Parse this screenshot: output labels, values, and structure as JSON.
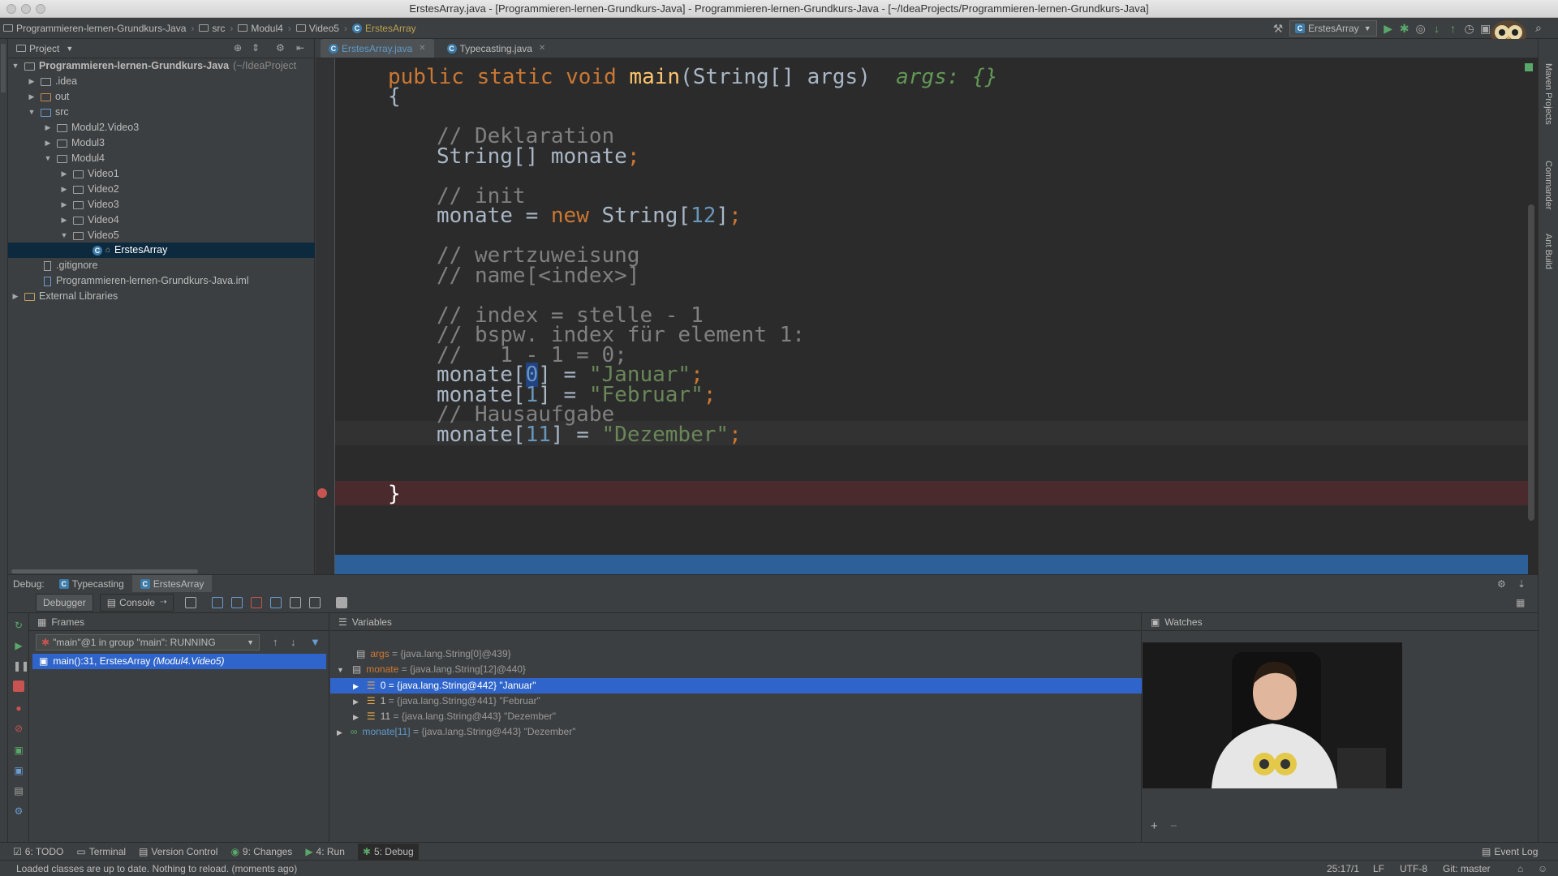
{
  "window": {
    "title": "ErstesArray.java - [Programmieren-lernen-Grundkurs-Java] - Programmieren-lernen-Grundkurs-Java - [~/IdeaProjects/Programmieren-lernen-Grundkurs-Java]"
  },
  "breadcrumbs": [
    "Programmieren-lernen-Grundkurs-Java",
    "src",
    "Modul4",
    "Video5",
    "ErstesArray"
  ],
  "run_config": "ErstesArray",
  "project": {
    "header": "Project",
    "root": "Programmieren-lernen-Grundkurs-Java",
    "root_path": "(~/IdeaProject",
    "items": [
      {
        "label": ".idea"
      },
      {
        "label": "out"
      },
      {
        "label": "src"
      },
      {
        "label": "Modul2.Video3"
      },
      {
        "label": "Modul3"
      },
      {
        "label": "Modul4"
      },
      {
        "label": "Video1"
      },
      {
        "label": "Video2"
      },
      {
        "label": "Video3"
      },
      {
        "label": "Video4"
      },
      {
        "label": "Video5"
      },
      {
        "label": "ErstesArray"
      },
      {
        "label": ".gitignore"
      },
      {
        "label": "Programmieren-lernen-Grundkurs-Java.iml"
      },
      {
        "label": "External Libraries"
      }
    ]
  },
  "editor": {
    "tabs": [
      {
        "label": "ErstesArray.java"
      },
      {
        "label": "Typecasting.java"
      }
    ]
  },
  "debug": {
    "label": "Debug:",
    "tabs": [
      "Typecasting",
      "ErstesArray"
    ],
    "subtabs": [
      "Debugger",
      "Console"
    ],
    "frames_header": "Frames",
    "thread": "\"main\"@1 in group \"main\": RUNNING",
    "frame": "main():31, ErstesArray",
    "frame_pkg": "(Modul4.Video5)",
    "variables_header": "Variables",
    "watches_header": "Watches",
    "variables": [
      {
        "name": "args",
        "value": "= {java.lang.String[0]@439}"
      },
      {
        "name": "monate",
        "value": "= {java.lang.String[12]@440}"
      },
      {
        "name": "0",
        "value": "= {java.lang.String@442} \"Januar\""
      },
      {
        "name": "1",
        "value": "= {java.lang.String@441} \"Februar\""
      },
      {
        "name": "11",
        "value": "= {java.lang.String@443} \"Dezember\""
      },
      {
        "name": "monate[11]",
        "value": "= {java.lang.String@443} \"Dezember\""
      }
    ]
  },
  "bottom_tools": [
    "6: TODO",
    "Terminal",
    "Version Control",
    "9: Changes",
    "4: Run",
    "5: Debug"
  ],
  "event_log": "Event Log",
  "status": {
    "message": "Loaded classes are up to date. Nothing to reload. (moments ago)",
    "position": "25:17/1",
    "line_sep": "LF",
    "encoding": "UTF-8",
    "git": "Git: master"
  },
  "right_strip": [
    "Maven Projects",
    "Commander",
    "Ant Build"
  ],
  "colors": {
    "keyword": "#cc7832",
    "string": "#6a8759",
    "number": "#6897bb",
    "comment": "#808080",
    "selection": "#2f65ca",
    "breakpoint": "#c75450"
  }
}
